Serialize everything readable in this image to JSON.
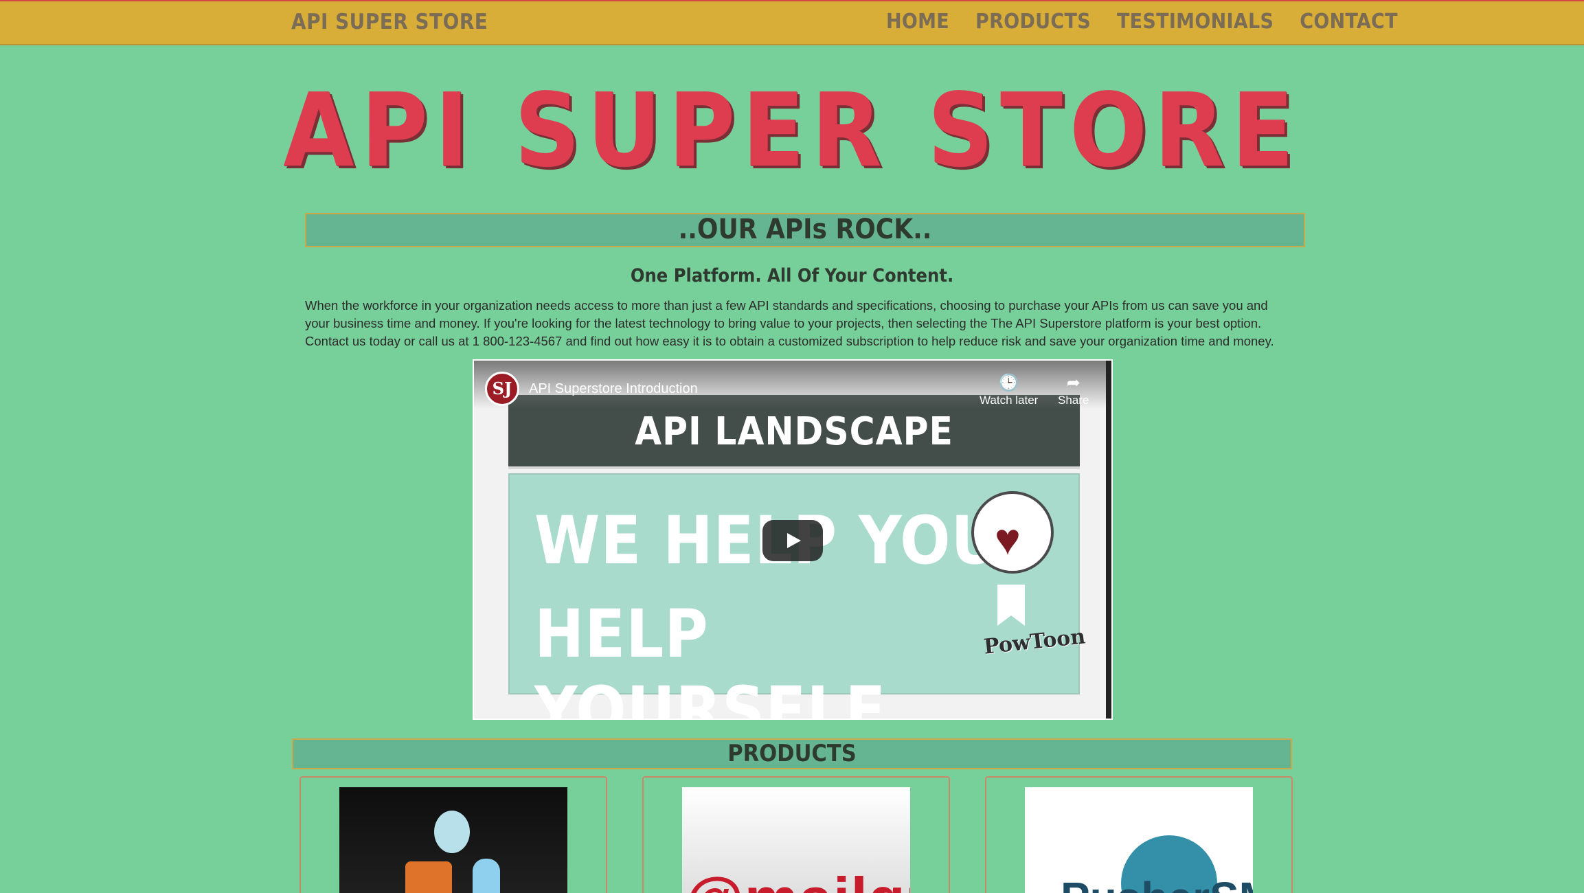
{
  "navbar": {
    "brand": "API SUPER STORE",
    "links": [
      "HOME",
      "PRODUCTS",
      "TESTIMONIALS",
      "CONTACT"
    ]
  },
  "hero": {
    "title": "API SUPER STORE"
  },
  "intro_section": {
    "heading": "..OUR APIs ROCK..",
    "tagline": "One Platform. All Of Your Content.",
    "paragraph": "When the workforce in your organization needs access to more than just a few API standards and specifications, choosing to purchase your APIs from us can save you and your business time and money. If you're looking for the latest technology to bring value to your projects, then selecting the The API Superstore platform is your best option. Contact us today or call us at 1 800-123-4567 and find out how easy it is to obtain a customized subscription to help reduce risk and save your organization time and money."
  },
  "video": {
    "channel_logo": "SJ",
    "title": "API Superstore Introduction",
    "watch_later": "Watch later",
    "share": "Share",
    "slide_header": "API LANDSCAPE",
    "slide_line1": "WE HELP YOU",
    "slide_line2": "HELP YOURSELF",
    "watermark": "PowToon",
    "icons": [
      "clock-icon",
      "share-icon",
      "play-icon",
      "heart-icon",
      "bookmark-icon"
    ]
  },
  "products_section": {
    "heading": "PRODUCTS",
    "items": [
      {
        "logo_text": ""
      },
      {
        "logo_text": "@mailgun"
      },
      {
        "logo_text": "PusherSMS"
      }
    ]
  },
  "colors": {
    "background": "#77cf99",
    "navbar": "#d9ae38",
    "hero_title": "#de3c4f",
    "section_bar": "#66b592"
  }
}
